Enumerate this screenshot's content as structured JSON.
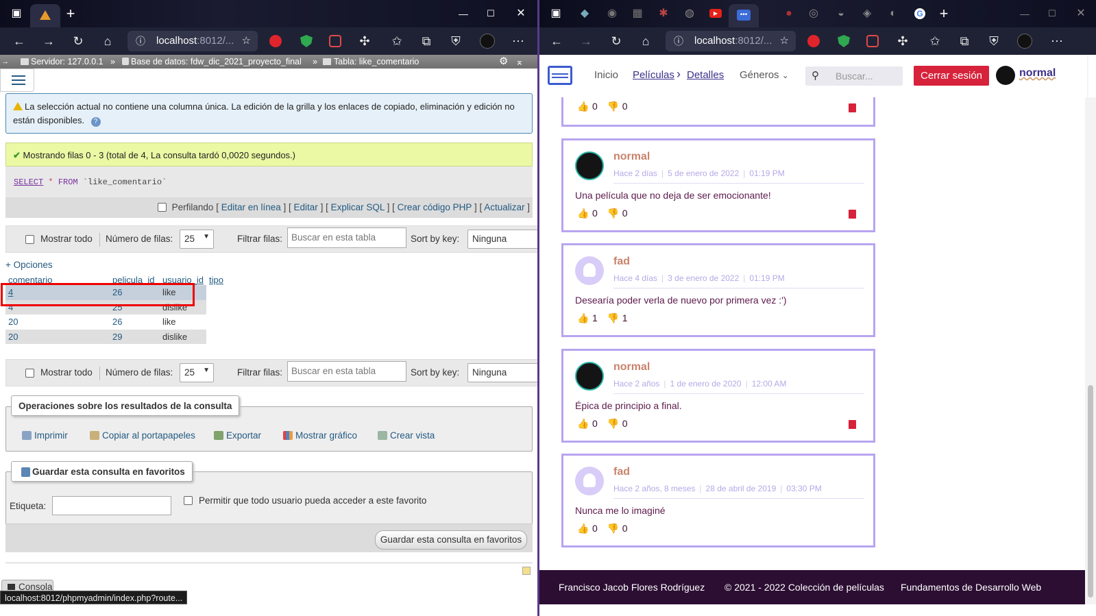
{
  "left_window": {
    "address": {
      "host": "localhost",
      "rest": ":8012/..."
    },
    "breadcrumb": {
      "server": "Servidor: 127.0.0.1",
      "sep1": "»",
      "database": "Base de datos: fdw_dic_2021_proyecto_final",
      "sep2": "»",
      "table": "Tabla: like_comentario"
    },
    "notice": "La selección actual no contiene una columna única. La edición de la grilla y los enlaces de copiado, eliminación y edición no están disponibles.",
    "success": "Mostrando filas 0 - 3 (total de 4, La consulta tardó 0,0020 segundos.)",
    "sql": {
      "select": "SELECT",
      "star": "*",
      "from": "FROM",
      "table": "`like_comentario`"
    },
    "sql_options": {
      "profiling": "Perfilando",
      "inline_edit": "Editar en línea",
      "edit": "Editar",
      "explain": "Explicar SQL",
      "php_code": "Crear código PHP",
      "refresh": "Actualizar"
    },
    "filters": {
      "show_all": "Mostrar todo",
      "rows_label": "Número de filas:",
      "rows_value": "25",
      "filter_label": "Filtrar filas:",
      "filter_placeholder": "Buscar en esta tabla",
      "sort_label": "Sort by key:",
      "sort_value": "Ninguna"
    },
    "options_link": "+ Opciones",
    "table": {
      "columns": [
        "comentario",
        "pelicula_id",
        "usuario_id",
        "tipo"
      ],
      "rows": [
        {
          "comentario": "4",
          "pelicula_id": "",
          "usuario_id": "26",
          "tipo": "like"
        },
        {
          "comentario": "4",
          "pelicula_id": "",
          "usuario_id": "25",
          "tipo": "dislike"
        },
        {
          "comentario": "20",
          "pelicula_id": "",
          "usuario_id": "26",
          "tipo": "like"
        },
        {
          "comentario": "20",
          "pelicula_id": "",
          "usuario_id": "29",
          "tipo": "dislike"
        }
      ]
    },
    "query_ops": {
      "title": "Operaciones sobre los resultados de la consulta",
      "print": "Imprimir",
      "copy": "Copiar al portapapeles",
      "export": "Exportar",
      "chart": "Mostrar gráfico",
      "view": "Crear vista"
    },
    "bookmark": {
      "title": "Guardar esta consulta en favoritos",
      "label": "Etiqueta:",
      "public": "Permitir que todo usuario pueda acceder a este favorito",
      "button": "Guardar esta consulta en favoritos"
    },
    "console": "Consola",
    "status_url": "localhost:8012/phpmyadmin/index.php?route..."
  },
  "right_window": {
    "address": {
      "host": "localhost",
      "rest": ":8012/..."
    },
    "nav": {
      "home": "Inicio",
      "movies": "Películas",
      "sep": "›",
      "details": "Detalles",
      "genres": "Géneros",
      "search_placeholder": "Buscar...",
      "logout": "Cerrar sesión",
      "user": "normal"
    },
    "comments_top": {
      "likes": "0",
      "dislikes": "0"
    },
    "comments": [
      {
        "user": "normal",
        "ago": "Hace 2 días",
        "date": "5 de enero de 2022",
        "time": "01:19 PM",
        "text": "Una película que no deja de ser emocionante!",
        "likes": "0",
        "dislikes": "0",
        "deletable": true,
        "avatar": "dark"
      },
      {
        "user": "fad",
        "ago": "Hace 4 días",
        "date": "3 de enero de 2022",
        "time": "01:19 PM",
        "text": "Desearía poder verla de nuevo por primera vez :')",
        "likes": "1",
        "dislikes": "1",
        "deletable": false,
        "avatar": "light"
      },
      {
        "user": "normal",
        "ago": "Hace 2 años",
        "date": "1 de enero de 2020",
        "time": "12:00 AM",
        "text": "Épica de principio a final.",
        "likes": "0",
        "dislikes": "0",
        "deletable": true,
        "avatar": "dark"
      },
      {
        "user": "fad",
        "ago": "Hace 2 años, 8 meses",
        "date": "28 de abril de 2019",
        "time": "03:30 PM",
        "text": "Nunca me lo imaginé",
        "likes": "0",
        "dislikes": "0",
        "deletable": false,
        "avatar": "light"
      }
    ],
    "footer": {
      "author": "Francisco Jacob Flores Rodríguez",
      "copy": "© 2021 - 2022 Colección de películas",
      "course": "Fundamentos de Desarrollo Web"
    }
  },
  "colors": {
    "accent_red": "#d6223a",
    "card_border": "#b8a4f0",
    "footer_bg": "#2c0e33",
    "username": "#c9826b"
  }
}
